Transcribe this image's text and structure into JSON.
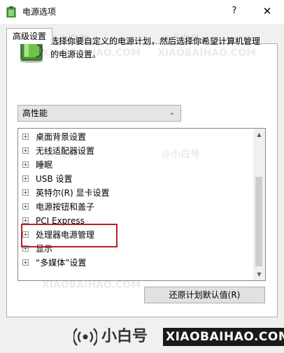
{
  "window": {
    "title": "电源选项",
    "help_glyph": "?",
    "close_glyph": "✕"
  },
  "tab": {
    "label": "高级设置"
  },
  "description": {
    "line1": "选择你要自定义的电源计划，然后选择你希望计算机管理",
    "line2": "的电源设置。"
  },
  "plan_select": {
    "value": "高性能"
  },
  "tree": {
    "items": [
      {
        "label": "桌面背景设置"
      },
      {
        "label": "无线适配器设置"
      },
      {
        "label": "睡眠"
      },
      {
        "label": "USB 设置"
      },
      {
        "label": "英特尔(R) 显卡设置"
      },
      {
        "label": "电源按钮和盖子"
      },
      {
        "label": "PCI Express"
      },
      {
        "label": "处理器电源管理"
      },
      {
        "label": "显示"
      },
      {
        "label": "“多媒体”设置"
      }
    ],
    "expand_glyph": "+"
  },
  "buttons": {
    "restore_defaults": "还原计划默认值(R)"
  },
  "watermark": {
    "cn": "小白号",
    "en": "XIAOBAIHAO.COM",
    "faint_cn": "@小白号",
    "faint_en": "XIAOBAIHAO.COM"
  },
  "colors": {
    "highlight_border": "#b5202b",
    "window_bg": "#f0f0f0"
  }
}
